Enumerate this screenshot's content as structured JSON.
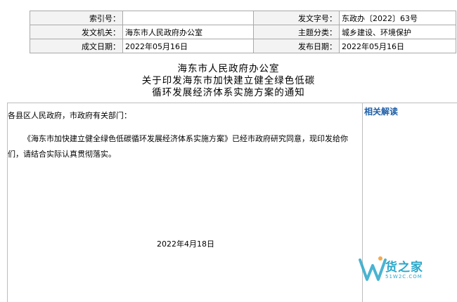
{
  "meta": {
    "index_label": "索引号：",
    "index_value": "",
    "doc_no_label": "发文字号：",
    "doc_no_value": "东政办〔2022〕63号",
    "issuer_label": "发文机关：",
    "issuer_value": "海东市人民政府办公室",
    "topic_label": "主题分类：",
    "topic_value": "城乡建设、环境保护",
    "created_label": "成文日期：",
    "created_value": "2022年05月16日",
    "published_label": "发布日期：",
    "published_value": "2022年05月16日"
  },
  "title": {
    "line1": "海东市人民政府办公室",
    "line2": "关于印发海东市加快建立健全绿色低碳",
    "line3": "循环发展经济体系实施方案的通知"
  },
  "body": {
    "salutation": "各县区人民政府，市政府有关部门：",
    "paragraph": "《海东市加快建立健全绿色低碳循环发展经济体系实施方案》已经市政府研究同意，现印发给你们，请结合实际认真贯彻落实。",
    "date": "2022年4月18日"
  },
  "sidebar": {
    "title": "相关解读"
  },
  "watermark": {
    "text": "货之家",
    "url": "51W2C.COM"
  },
  "colors": {
    "sidebar_title": "#1f5fa8",
    "watermark": "#2aa7c9",
    "border": "#a9a9a9"
  }
}
